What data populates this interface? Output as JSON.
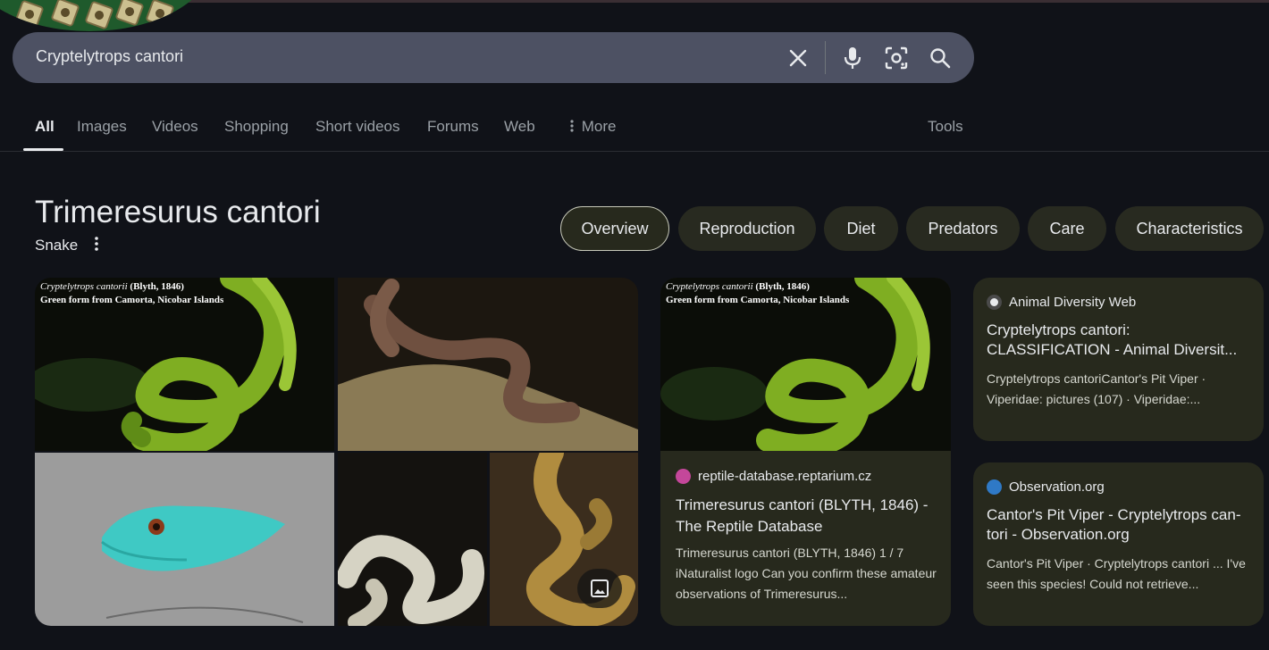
{
  "search": {
    "query": "Cryptelytrops cantori"
  },
  "icons": {
    "clear": "close-icon",
    "voice": "microphone-icon",
    "lens": "camera-lens-icon",
    "search": "search-icon",
    "more": "more-vert-icon",
    "photos": "image-icon"
  },
  "tabs": [
    {
      "label": "All",
      "active": true
    },
    {
      "label": "Images"
    },
    {
      "label": "Videos"
    },
    {
      "label": "Shopping"
    },
    {
      "label": "Short videos"
    },
    {
      "label": "Forums"
    },
    {
      "label": "Web"
    },
    {
      "label": "More"
    }
  ],
  "tools_label": "Tools",
  "entity": {
    "title": "Trimeresurus cantori",
    "subtitle": "Snake"
  },
  "chips": [
    {
      "label": "Overview",
      "selected": true
    },
    {
      "label": "Reproduction"
    },
    {
      "label": "Diet"
    },
    {
      "label": "Predators"
    },
    {
      "label": "Care"
    },
    {
      "label": "Characteristics"
    }
  ],
  "image_caption": {
    "species": "Cryptelytrops cantorii",
    "author": "(Blyth, 1846)",
    "line2": "Green form from Camorta, Nicobar Islands"
  },
  "cards": [
    {
      "source": "reptile-database.reptarium.cz",
      "title": "Trimeresurus cantori (BLYTH, 1846) - The Reptile Database",
      "snippet": "Trimeresurus cantori (BLYTH, 1846) 1 / 7 iNaturalist logo Can you confirm these amateur observations of Trimeresurus..."
    },
    {
      "source": "Animal Diversity Web",
      "title": "Cryptelytrops cantori: CLASSIFICATION - Animal Diversit...",
      "snippet": "Cryptelytrops cantoriCantor's Pit Viper · Viperidae: pictures (107) · Viperidae:..."
    },
    {
      "source": "Observation.org",
      "title": "Cantor's Pit Viper - Cryptelytrops can-tori - Observation.org",
      "snippet": "Cantor's Pit Viper · Cryptelytrops cantori ... I've seen this species! Could not retrieve..."
    }
  ],
  "colors": {
    "background": "#101218",
    "searchbar": "#4d5163",
    "card": "#27291d",
    "chip": "#282a20"
  }
}
